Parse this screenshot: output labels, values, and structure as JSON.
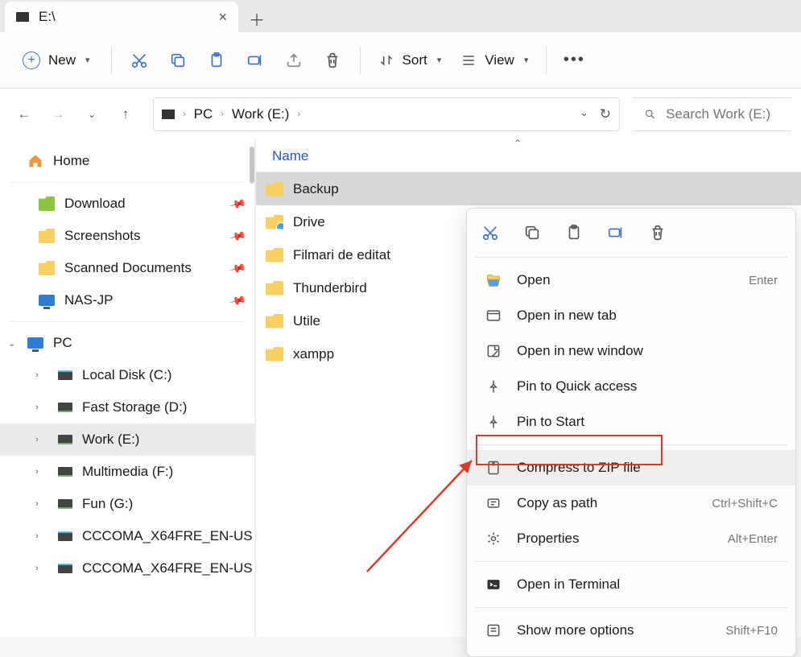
{
  "tab": {
    "title": "E:\\"
  },
  "toolbar": {
    "new_label": "New",
    "sort_label": "Sort",
    "view_label": "View"
  },
  "breadcrumb": {
    "seg1": "PC",
    "seg2": "Work (E:)"
  },
  "search": {
    "placeholder": "Search Work (E:)"
  },
  "sidebar": {
    "home": "Home",
    "quick": [
      {
        "label": "Download"
      },
      {
        "label": "Screenshots"
      },
      {
        "label": "Scanned Documents"
      },
      {
        "label": "NAS-JP"
      }
    ],
    "pc_label": "PC",
    "drives": [
      {
        "label": "Local Disk (C:)"
      },
      {
        "label": "Fast Storage (D:)"
      },
      {
        "label": "Work (E:)"
      },
      {
        "label": "Multimedia (F:)"
      },
      {
        "label": "Fun (G:)"
      },
      {
        "label": "CCCOMA_X64FRE_EN-US"
      },
      {
        "label": "CCCOMA_X64FRE_EN-US"
      }
    ]
  },
  "column": {
    "name": "Name"
  },
  "files": [
    {
      "name": "Backup"
    },
    {
      "name": "Drive"
    },
    {
      "name": "Filmari de editat"
    },
    {
      "name": "Thunderbird"
    },
    {
      "name": "Utile"
    },
    {
      "name": "xampp"
    }
  ],
  "ctx": {
    "open": "Open",
    "open_sc": "Enter",
    "open_tab": "Open in new tab",
    "open_win": "Open in new window",
    "pin_quick": "Pin to Quick access",
    "pin_start": "Pin to Start",
    "compress": "Compress to ZIP file",
    "copy_path": "Copy as path",
    "copy_path_sc": "Ctrl+Shift+C",
    "properties": "Properties",
    "properties_sc": "Alt+Enter",
    "terminal": "Open in Terminal",
    "more": "Show more options",
    "more_sc": "Shift+F10"
  }
}
